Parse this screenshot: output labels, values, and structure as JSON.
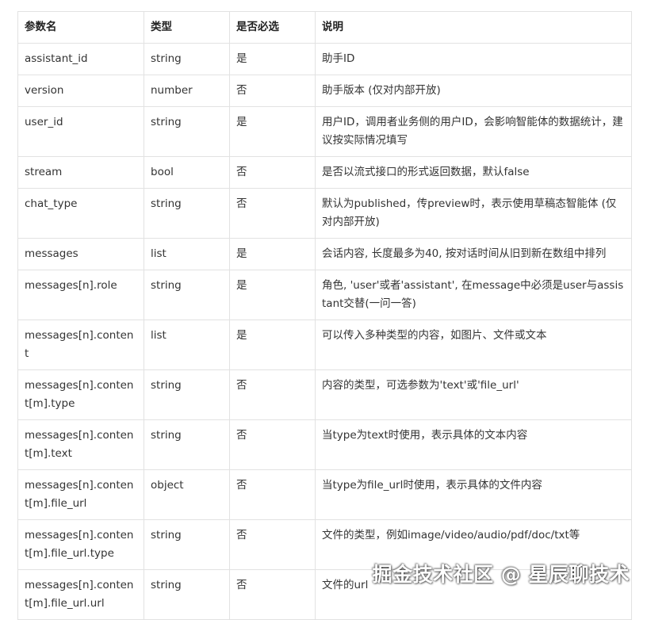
{
  "table": {
    "headers": [
      "参数名",
      "类型",
      "是否必选",
      "说明"
    ],
    "rows": [
      {
        "name": "assistant_id",
        "type": "string",
        "required": "是",
        "desc": "助手ID"
      },
      {
        "name": "version",
        "type": "number",
        "required": "否",
        "desc": "助手版本 (仅对内部开放)"
      },
      {
        "name": "user_id",
        "type": "string",
        "required": "是",
        "desc": "用户ID，调用者业务侧的用户ID，会影响智能体的数据统计，建议按实际情况填写"
      },
      {
        "name": "stream",
        "type": "bool",
        "required": "否",
        "desc": "是否以流式接口的形式返回数据，默认false"
      },
      {
        "name": "chat_type",
        "type": "string",
        "required": "否",
        "desc": "默认为published，传preview时，表示使用草稿态智能体 (仅对内部开放)"
      },
      {
        "name": "messages",
        "type": "list",
        "required": "是",
        "desc": "会话内容, 长度最多为40, 按对话时间从旧到新在数组中排列"
      },
      {
        "name": "messages[n].role",
        "type": "string",
        "required": "是",
        "desc": "角色, 'user'或者'assistant', 在message中必须是user与assistant交替(一问一答)"
      },
      {
        "name": "messages[n].content",
        "type": "list",
        "required": "是",
        "desc": "可以传入多种类型的内容，如图片、文件或文本"
      },
      {
        "name": "messages[n].content[m].type",
        "type": "string",
        "required": "否",
        "desc": "内容的类型，可选参数为'text'或'file_url'"
      },
      {
        "name": "messages[n].content[m].text",
        "type": "string",
        "required": "否",
        "desc": "当type为text时使用，表示具体的文本内容"
      },
      {
        "name": "messages[n].content[m].file_url",
        "type": "object",
        "required": "否",
        "desc": "当type为file_url时使用，表示具体的文件内容"
      },
      {
        "name": "messages[n].content[m].file_url.type",
        "type": "string",
        "required": "否",
        "desc": "文件的类型，例如image/video/audio/pdf/doc/txt等"
      },
      {
        "name": "messages[n].content[m].file_url.url",
        "type": "string",
        "required": "否",
        "desc": "文件的url"
      }
    ]
  },
  "watermark": "掘金技术社区 @ 星辰聊技术"
}
